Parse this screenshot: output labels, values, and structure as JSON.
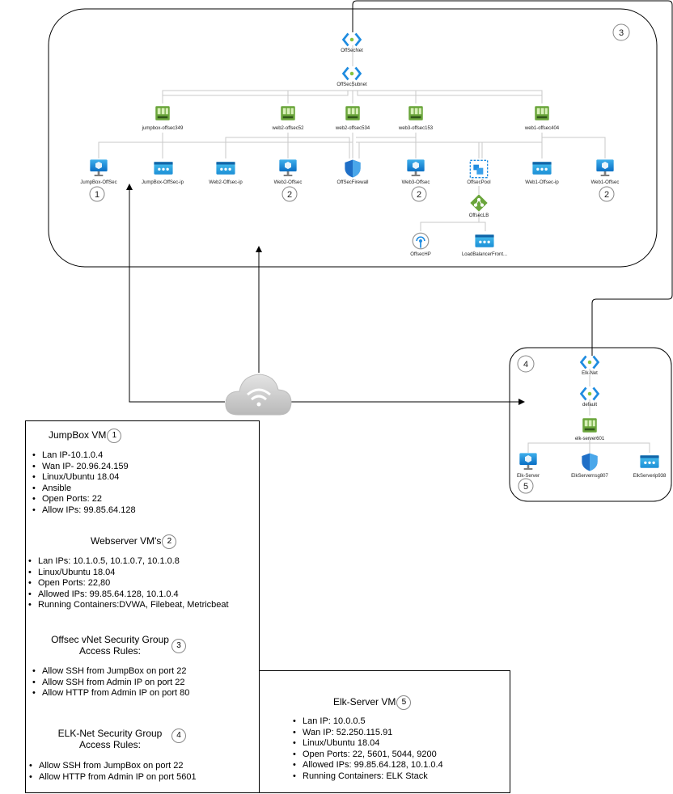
{
  "diagram": {
    "offsec": {
      "badge": "3",
      "nodes": {
        "vnet": "OffSecNet",
        "subnet": "OffSecSubnet",
        "nic_jump": "jumpbox-offsec349",
        "nic_web2": "web2-offsec52",
        "nic_web2b": "web2-offsec534",
        "nic_web3": "web3-offsec153",
        "nic_web1": "web1-offsec404",
        "vm_jump": "JumpBox-OffSec",
        "ip_jump": "JumpBox-OffSec-ip",
        "ip_web2": "Web2-Offsec-ip",
        "vm_web2": "Web2-Offsec",
        "firewall": "OffSecFirewall",
        "vm_web3": "Web3-Offsec",
        "pool": "OffsecPool",
        "ip_web1": "Web1-Offsec-ip",
        "vm_web1": "Web1-Offsec",
        "lb": "OffsecLB",
        "hp": "OffsecHP",
        "lbfront": "LoadBalancerFront..."
      },
      "node_badges": {
        "vm_jump": "1",
        "vm_web2": "2",
        "vm_web3": "2",
        "vm_web1": "2"
      }
    },
    "elk": {
      "badge": "4",
      "nodes": {
        "vnet": "Elk-Net",
        "subnet": "default",
        "nic": "elk-server601",
        "vm": "Elk-Server",
        "nsg": "ElkServernsg807",
        "ip": "ElkServerip938"
      },
      "node_badges": {
        "vm": "5"
      }
    }
  },
  "info": {
    "jumpbox": {
      "title": "JumpBox VM",
      "badge": "1",
      "items": [
        "Lan IP-10.1.0.4",
        "Wan IP- 20.96.24.159",
        "Linux/Ubuntu 18.04",
        "Ansible",
        "Open Ports: 22",
        "Allow IPs: 99.85.64.128"
      ]
    },
    "webservers": {
      "title": "Webserver VM's",
      "badge": "2",
      "items": [
        "Lan IPs: 10.1.0.5, 10.1.0.7, 10.1.0.8",
        "Linux/Ubuntu 18.04",
        "Open Ports: 22,80",
        "Allowed IPs: 99.85.64.128, 10.1.0.4",
        "Running Containers:DVWA, Filebeat, Metricbeat"
      ]
    },
    "offsec_nsg": {
      "title_line1": "Offsec vNet Security Group",
      "title_line2": "Access Rules:",
      "badge": "3",
      "items": [
        "Allow SSH from JumpBox on port 22",
        "Allow SSH from Admin IP on port 22",
        "Allow HTTP from Admin IP on port 80"
      ]
    },
    "elk_nsg": {
      "title_line1": "ELK-Net Security Group",
      "title_line2": "Access Rules:",
      "badge": "4",
      "items": [
        "Allow SSH from JumpBox on port 22",
        "Allow HTTP from Admin IP on port 5601"
      ]
    },
    "elk_server": {
      "title": "Elk-Server VM",
      "badge": "5",
      "items": [
        "Lan IP: 10.0.0.5",
        "Wan IP: 52.250.115.91",
        "Linux/Ubuntu 18.04",
        "Open Ports: 22, 5601, 5044, 9200",
        "Allowed IPs: 99.85.64.128, 10.1.0.4",
        "Running Containers: ELK Stack"
      ]
    }
  }
}
